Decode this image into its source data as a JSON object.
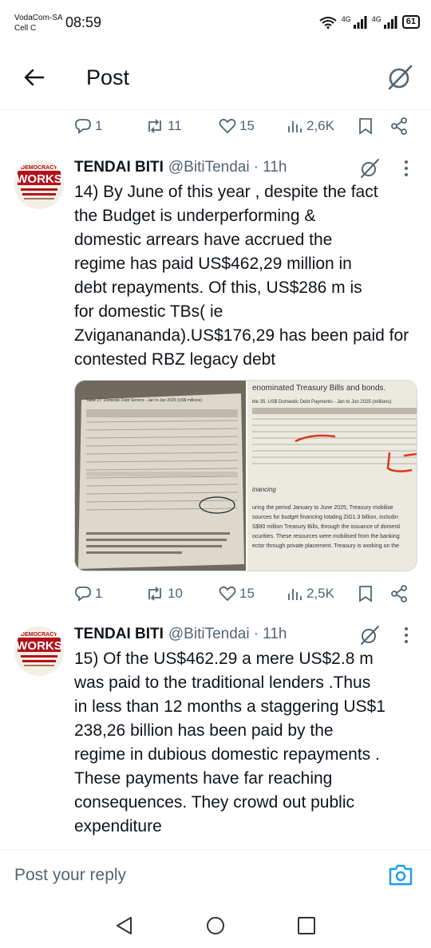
{
  "status_bar": {
    "carrier_line1": "VodaCom-SA",
    "carrier_line2": "Cell C",
    "time": "08:59",
    "net1": "4G",
    "net2": "4G",
    "battery": "61"
  },
  "header": {
    "title": "Post"
  },
  "top_actions": {
    "replies": "1",
    "reposts": "11",
    "likes": "15",
    "views": "2,6K"
  },
  "tweets": [
    {
      "name": "TENDAI BITI",
      "handle": "@BitiTendai",
      "time": "· 11h",
      "text": "14) By June of this year , despite the fact\nthe Budget is underperforming &\ndomestic arrears have accrued the\nregime has paid US$462,29 million in\ndebt repayments. Of this, US$286 m is\nfor domestic TBs( ie\nZviganananda).US$176,29 has been paid for\ncontested RBZ legacy debt",
      "actions": {
        "replies": "1",
        "reposts": "10",
        "likes": "15",
        "views": "2,5K"
      }
    },
    {
      "name": "TENDAI BITI",
      "handle": "@BitiTendai",
      "time": "· 11h",
      "text": "15) Of the US$462.29 a mere US$2.8 m\nwas paid to the traditional lenders .Thus\nin less than 12 months a staggering US$1\n238,26 billion has been paid by the\nregime in dubious domestic repayments .\nThese payments have far reaching\nconsequences. They crowd out public\nexpenditure"
    }
  ],
  "media": {
    "left_caption": "Table 27: Domestic Debt Service - Jan to Jun 2025 (US$ millions)",
    "right_heading": "enominated Treasury Bills and bonds.",
    "right_caption": "ble 35: US$ Domestic Debt Payments - Jan to Jun 2025 (millions)",
    "right_section": "inancing",
    "right_para": "uring the period January to June 2025, Treasury mobilise\nsources for budget financing totaling ZiG1.3 billion, includin\nS$90 million Treasury Bills, through the issuance of domesti\nocurities. These resources were mobilised from the banking\nector through private placement. Treasury is working on the"
  },
  "reply": {
    "placeholder": "Post your reply"
  },
  "colors": {
    "muted": "#536471",
    "text": "#0f1419",
    "accent": "#1d9bf0",
    "divider": "#eff3f4"
  }
}
